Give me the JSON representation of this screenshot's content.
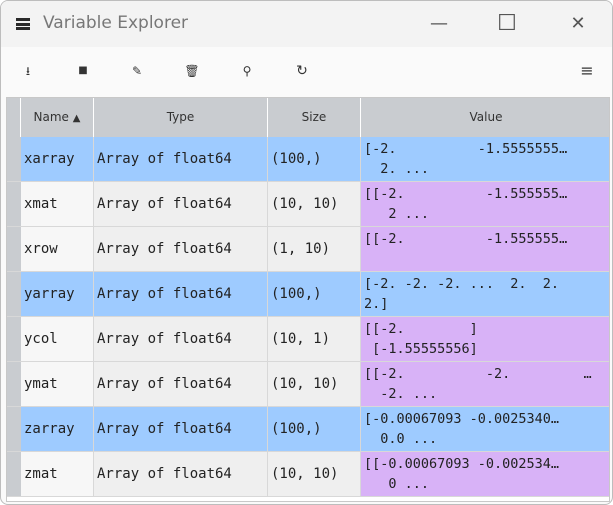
{
  "window": {
    "title": "Variable Explorer",
    "minimize": "—",
    "maximize": "☐",
    "close": "✕"
  },
  "toolbar": {
    "import": "⭳",
    "save": "■",
    "save_as": "✎",
    "delete": "🗑",
    "search": "⚲",
    "refresh": "↻",
    "menu": "≡"
  },
  "table": {
    "headers": {
      "name": "Name",
      "sort": "▲",
      "type": "Type",
      "size": "Size",
      "value": "Value"
    },
    "colors": {
      "array": "#9ecbff",
      "matrix": "#d8b2f7",
      "name_bg": "#f7f7f7",
      "cell_bg": "#efefef"
    },
    "rows": [
      {
        "name": "xarray",
        "type": "Array of float64",
        "size": "(100,)",
        "value1": "[-2.          -1.5555555…",
        "value2": "  2. ...",
        "kind": "array"
      },
      {
        "name": "xmat",
        "type": "Array of float64",
        "size": "(10, 10)",
        "value1": "[[-2.          -1.555555…",
        "value2": "   2 ...",
        "kind": "matrix"
      },
      {
        "name": "xrow",
        "type": "Array of float64",
        "size": "(1, 10)",
        "value1": "",
        "value2": "[[-2.          -1.555555…",
        "kind": "matrix"
      },
      {
        "name": "yarray",
        "type": "Array of float64",
        "size": "(100,)",
        "value1": "[-2. -2. -2. ...  2.  2.",
        "value2": "2.]",
        "kind": "array"
      },
      {
        "name": "ycol",
        "type": "Array of float64",
        "size": "(10, 1)",
        "value1": "[[-2.        ]",
        "value2": " [-1.55555556]",
        "kind": "matrix"
      },
      {
        "name": "ymat",
        "type": "Array of float64",
        "size": "(10, 10)",
        "value1": "[[-2.          -2.         …",
        "value2": "  -2. ...",
        "kind": "matrix"
      },
      {
        "name": "zarray",
        "type": "Array of float64",
        "size": "(100,)",
        "value1": "[-0.00067093 -0.0025340…",
        "value2": "  0.0 ...",
        "kind": "array"
      },
      {
        "name": "zmat",
        "type": "Array of float64",
        "size": "(10, 10)",
        "value1": "[[-0.00067093 -0.002534…",
        "value2": "   0 ...",
        "kind": "matrix"
      }
    ]
  }
}
